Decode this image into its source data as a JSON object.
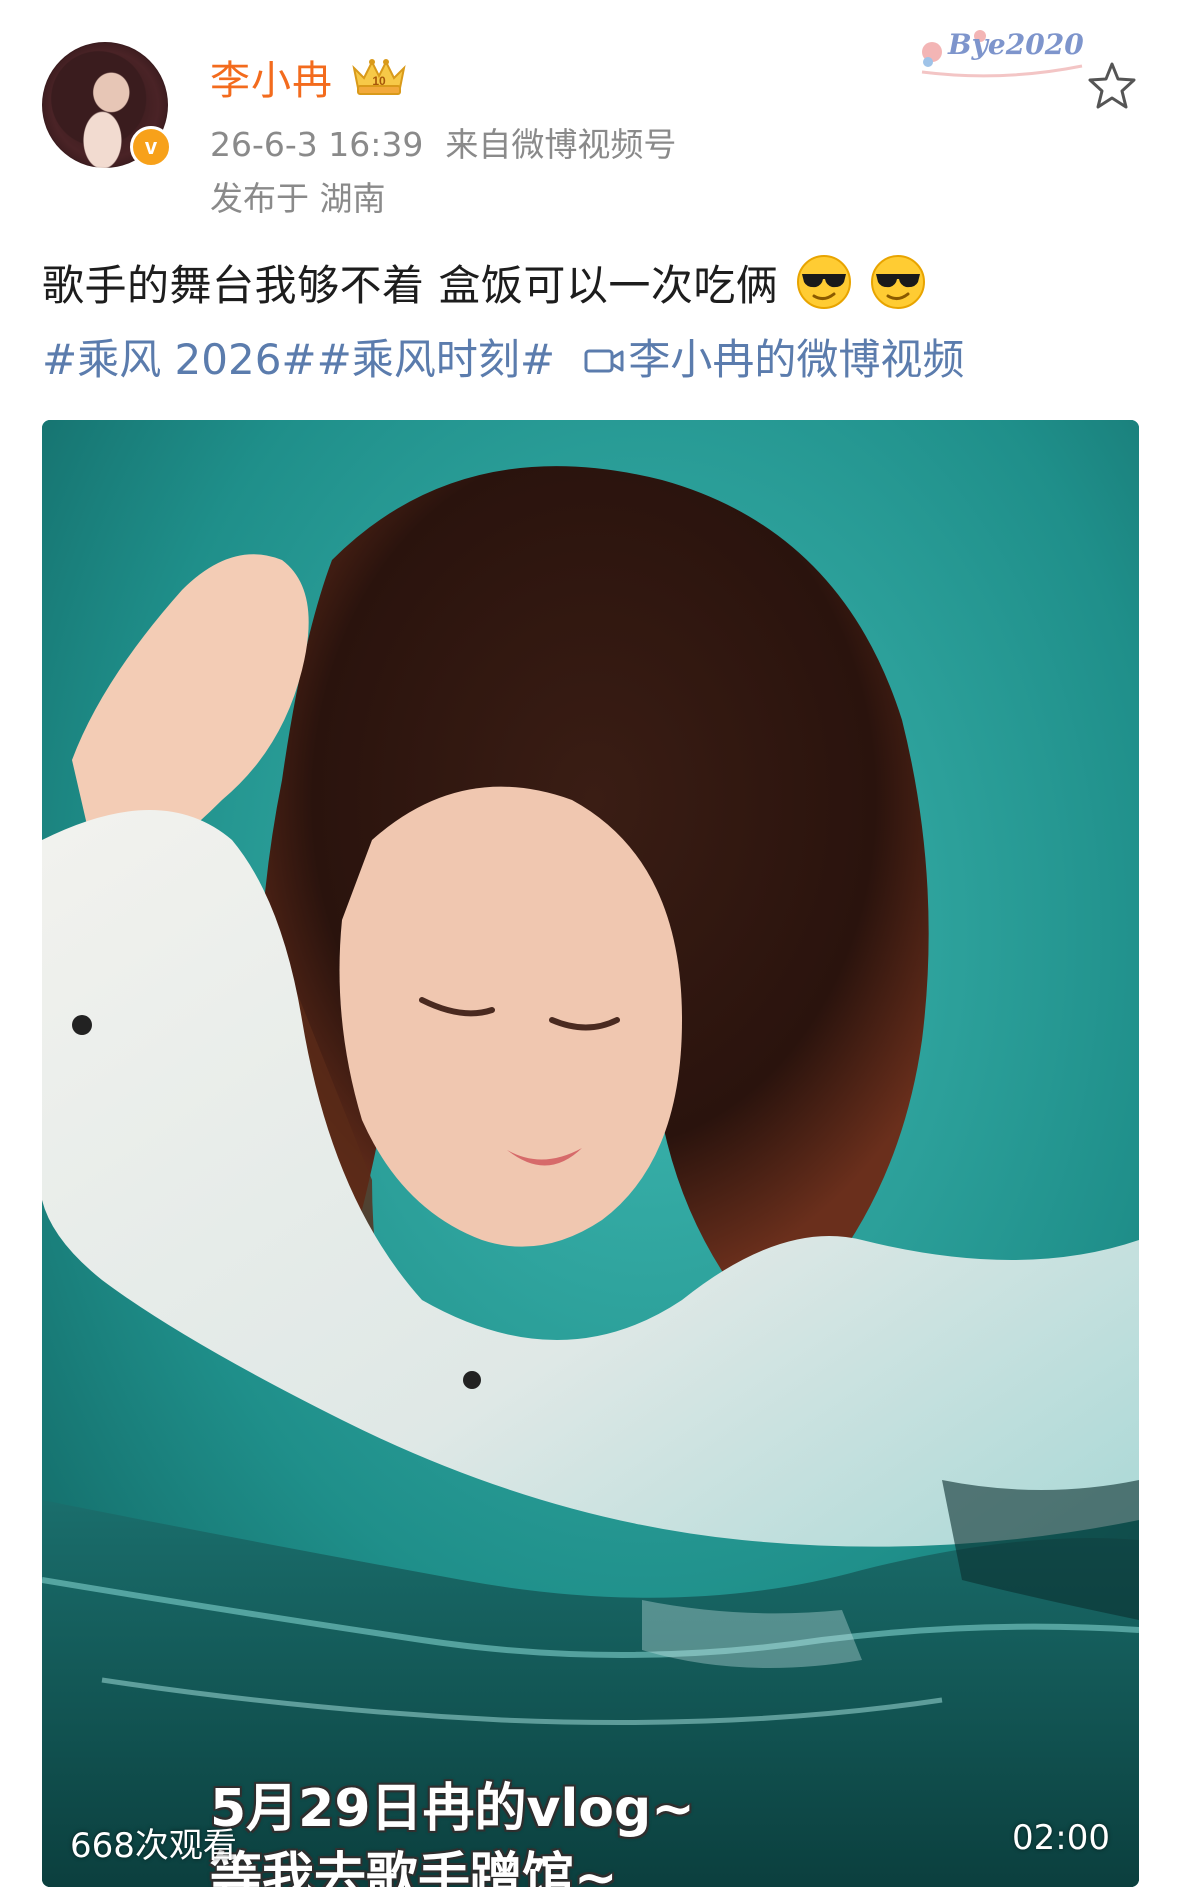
{
  "header": {
    "username": "李小冉",
    "timestamp": "26-6-3 16:39",
    "source": "来自微博视频号",
    "location": "发布于 湖南",
    "verified_badge": "v"
  },
  "watermark": {
    "text": "Bye2020"
  },
  "post": {
    "text": "歌手的舞台我够不着 盒饭可以一次吃俩",
    "topics": [
      "#乘风 2026#",
      "#乘风时刻#"
    ],
    "video_link": "李小冉的微博视频"
  },
  "video": {
    "subtitle_line1": "5月29日冉的vlog~",
    "subtitle_line2": "等我去歌手蹭馆~",
    "view_count": "668次观看",
    "duration": "02:00"
  },
  "icons": {
    "star": "star-icon",
    "vip": "crown-icon",
    "emoji": "sunglasses-emoji-icon",
    "video": "video-camera-icon"
  },
  "colors": {
    "username": "#f36b1d",
    "topic": "#5b7cad",
    "meta": "#8a8a8a",
    "badge": "#f7a11a",
    "video_bg": "#1f8f8a"
  }
}
